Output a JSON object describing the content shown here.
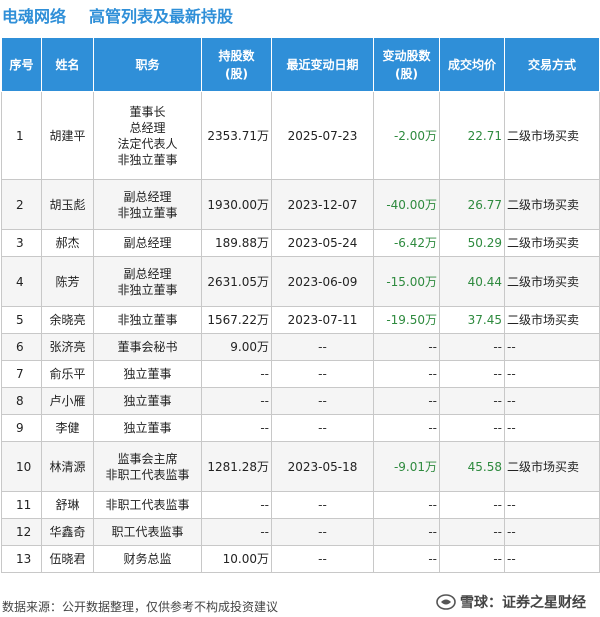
{
  "title": {
    "company": "电魂网络",
    "text": "高管列表及最新持股"
  },
  "headers": {
    "idx": "序号",
    "name": "姓名",
    "position": "职务",
    "holding_l1": "持股数",
    "holding_l2": "(股)",
    "date": "最近变动日期",
    "change_l1": "变动股数",
    "change_l2": "(股)",
    "price": "成交均价",
    "mode": "交易方式"
  },
  "rows": [
    {
      "idx": "1",
      "name": "胡建平",
      "positions": [
        "董事长",
        "总经理",
        "法定代表人",
        "非独立董事"
      ],
      "holding": "2353.71万",
      "date": "2025-07-23",
      "change": "-2.00万",
      "price": "22.71",
      "mode": "二级市场买卖"
    },
    {
      "idx": "2",
      "name": "胡玉彪",
      "positions": [
        "副总经理",
        "非独立董事"
      ],
      "holding": "1930.00万",
      "date": "2023-12-07",
      "change": "-40.00万",
      "price": "26.77",
      "mode": "二级市场买卖"
    },
    {
      "idx": "3",
      "name": "郝杰",
      "positions": [
        "副总经理"
      ],
      "holding": "189.88万",
      "date": "2023-05-24",
      "change": "-6.42万",
      "price": "50.29",
      "mode": "二级市场买卖"
    },
    {
      "idx": "4",
      "name": "陈芳",
      "positions": [
        "副总经理",
        "非独立董事"
      ],
      "holding": "2631.05万",
      "date": "2023-06-09",
      "change": "-15.00万",
      "price": "40.44",
      "mode": "二级市场买卖"
    },
    {
      "idx": "5",
      "name": "余晓亮",
      "positions": [
        "非独立董事"
      ],
      "holding": "1567.22万",
      "date": "2023-07-11",
      "change": "-19.50万",
      "price": "37.45",
      "mode": "二级市场买卖"
    },
    {
      "idx": "6",
      "name": "张济亮",
      "positions": [
        "董事会秘书"
      ],
      "holding": "9.00万",
      "date": "--",
      "change": "--",
      "price": "--",
      "mode": "--"
    },
    {
      "idx": "7",
      "name": "俞乐平",
      "positions": [
        "独立董事"
      ],
      "holding": "--",
      "date": "--",
      "change": "--",
      "price": "--",
      "mode": "--"
    },
    {
      "idx": "8",
      "name": "卢小雁",
      "positions": [
        "独立董事"
      ],
      "holding": "--",
      "date": "--",
      "change": "--",
      "price": "--",
      "mode": "--"
    },
    {
      "idx": "9",
      "name": "李健",
      "positions": [
        "独立董事"
      ],
      "holding": "--",
      "date": "--",
      "change": "--",
      "price": "--",
      "mode": "--"
    },
    {
      "idx": "10",
      "name": "林清源",
      "positions": [
        "监事会主席",
        "非职工代表监事"
      ],
      "holding": "1281.28万",
      "date": "2023-05-18",
      "change": "-9.01万",
      "price": "45.58",
      "mode": "二级市场买卖"
    },
    {
      "idx": "11",
      "name": "舒琳",
      "positions": [
        "非职工代表监事"
      ],
      "holding": "--",
      "date": "--",
      "change": "--",
      "price": "--",
      "mode": "--"
    },
    {
      "idx": "12",
      "name": "华鑫奇",
      "positions": [
        "职工代表监事"
      ],
      "holding": "--",
      "date": "--",
      "change": "--",
      "price": "--",
      "mode": "--"
    },
    {
      "idx": "13",
      "name": "伍晓君",
      "positions": [
        "财务总监"
      ],
      "holding": "10.00万",
      "date": "--",
      "change": "--",
      "price": "--",
      "mode": "--"
    }
  ],
  "footer": {
    "source": "数据来源：公开数据整理，仅供参考不构成投资建议",
    "brand": "雪球：证券之星财经",
    "brand_icon": "snowball-logo-icon"
  },
  "colors": {
    "accent": "#2f8fd8",
    "change_green": "#2e8a3e",
    "row_alt": "#f5f5f5"
  }
}
